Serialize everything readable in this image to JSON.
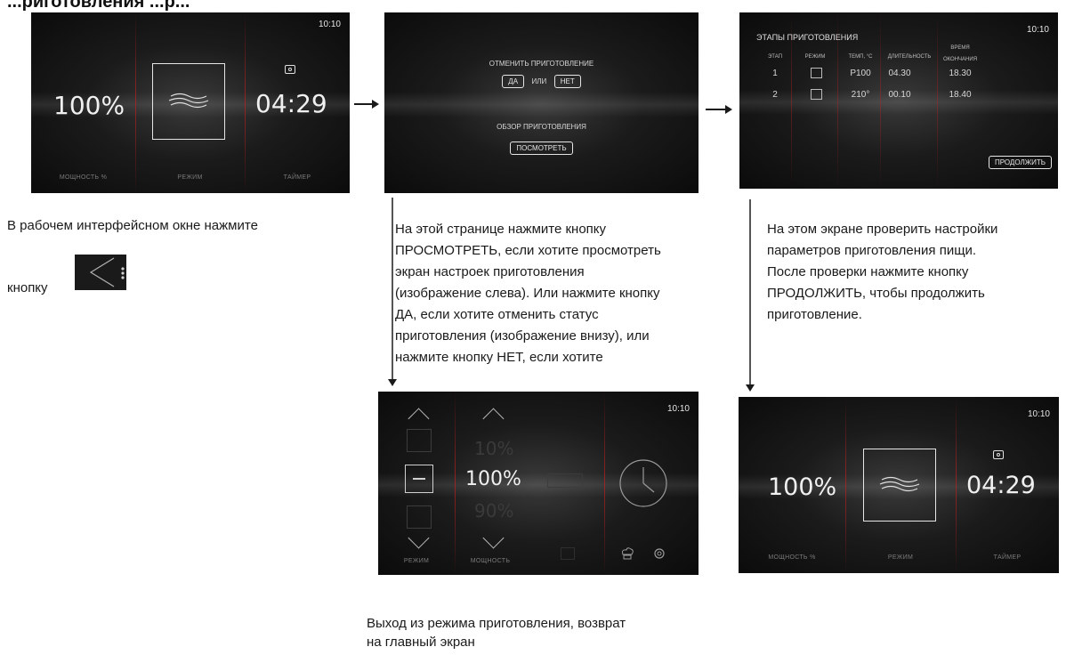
{
  "heading": "...риготовления ...р...",
  "screens": {
    "main": {
      "clock": "10:10",
      "power": "100%",
      "timer": "04:29",
      "labels": {
        "power": "МОЩНОСТЬ %",
        "mode": "РЕЖИМ",
        "timer": "ТАЙМЕР"
      }
    },
    "cancel": {
      "question": "ОТМЕНИТЬ ПРИГОТОВЛЕНИЕ",
      "yes": "ДА",
      "or": "ИЛИ",
      "no": "НЕТ",
      "review_title": "ОБЗОР ПРИГОТОВЛЕНИЯ",
      "view": "ПОСМОТРЕТЬ"
    },
    "stages": {
      "title": "ЭТАПЫ ПРИГОТОВЛЕНИЯ",
      "clock": "10:10",
      "headers": [
        "ЭТАП",
        "РЕЖИМ",
        "ТЕМП, °С",
        "ДЛИТЕЛЬНОСТЬ",
        "ВРЕМЯ ОКОНЧАНИЯ"
      ],
      "rows": [
        {
          "stage": "1",
          "temp": "P100",
          "duration": "04.30",
          "end": "18.30"
        },
        {
          "stage": "2",
          "temp": "210°",
          "duration": "00.10",
          "end": "18.40"
        }
      ],
      "continue": "ПРОДОЛЖИТЬ"
    },
    "setup": {
      "clock": "10:10",
      "power_above": "10%",
      "power": "100%",
      "power_below": "90%",
      "labels": {
        "mode": "РЕЖИМ",
        "power": "МОЩНОСТЬ"
      }
    },
    "main2": {
      "clock": "10:10",
      "power": "100%",
      "timer": "04:29",
      "labels": {
        "power": "МОЩНОСТЬ %",
        "mode": "РЕЖИМ",
        "timer": "ТАЙМЕР"
      }
    }
  },
  "captions": {
    "left_1": "В рабочем интерфейсном окне нажмите",
    "left_2": "кнопку",
    "middle": [
      "На этой странице нажмите кнопку",
      "ПРОСМОТРЕТЬ, если хотите просмотреть",
      "экран настроек приготовления",
      "(изображение слева). Или нажмите кнопку",
      "ДА, если хотите отменить статус",
      "приготовления (изображение внизу), или",
      "нажмите кнопку НЕТ, если хотите"
    ],
    "right": [
      "На этом экране проверить настройки",
      "параметров приготовления пищи.",
      "После проверки нажмите кнопку",
      "ПРОДОЛЖИТЬ, чтобы продолжить",
      "приготовление."
    ],
    "bottom": [
      "Выход из режима приготовления, возврат",
      "на главный экран"
    ]
  }
}
